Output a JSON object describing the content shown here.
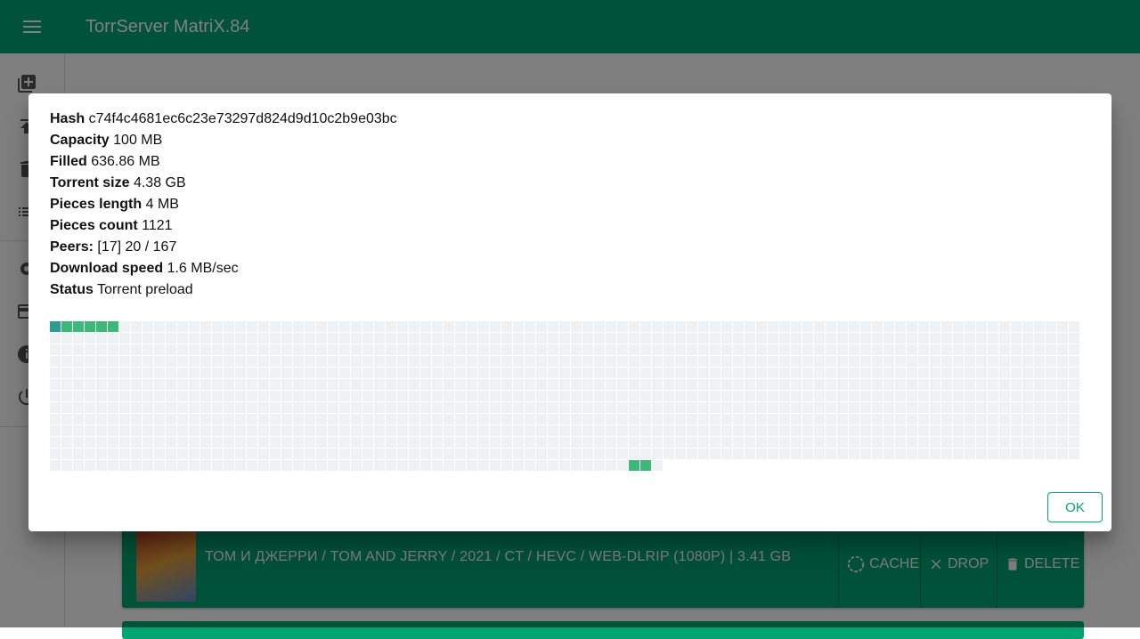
{
  "app": {
    "title": "TorrServer MatriX.84"
  },
  "colors": {
    "primary": "#00a572",
    "piece_empty": "#eef2f5",
    "piece_filled": "#3cb878",
    "piece_active": "#2a9d8f"
  },
  "sidebar": {
    "icons": [
      "add-box-icon",
      "upload-icon",
      "delete-icon",
      "list-icon",
      "settings-icon",
      "credit-card-icon",
      "info-icon",
      "power-icon"
    ]
  },
  "dialog": {
    "fields": [
      {
        "label": "Hash",
        "value": "c74f4c4681ec6c23e73297d824d9d10c2b9e03bc"
      },
      {
        "label": "Capacity",
        "value": "100 MB"
      },
      {
        "label": "Filled",
        "value": "636.86 MB"
      },
      {
        "label": "Torrent size",
        "value": "4.38 GB"
      },
      {
        "label": "Pieces length",
        "value": "4 MB"
      },
      {
        "label": "Pieces count",
        "value": "1121"
      },
      {
        "label": "Peers:",
        "value": "[17] 20 / 167"
      },
      {
        "label": "Download speed",
        "value": "1.6 MB/sec"
      },
      {
        "label": "Status",
        "value": "Torrent preload"
      }
    ],
    "pieces": {
      "count": 1121,
      "per_row": 89,
      "active": [
        0
      ],
      "filled": [
        1,
        2,
        3,
        4,
        5,
        1118,
        1119
      ]
    },
    "ok_label": "OK"
  },
  "torrent": {
    "title": "ТОМ И ДЖЕРРИ / TOM AND JERRY / 2021 / CT / HEVC / WEB-DLRIP (1080P) | 3.41 GB",
    "cache_label": "CACHE",
    "drop_label": "DROP",
    "delete_label": "DELETE"
  }
}
